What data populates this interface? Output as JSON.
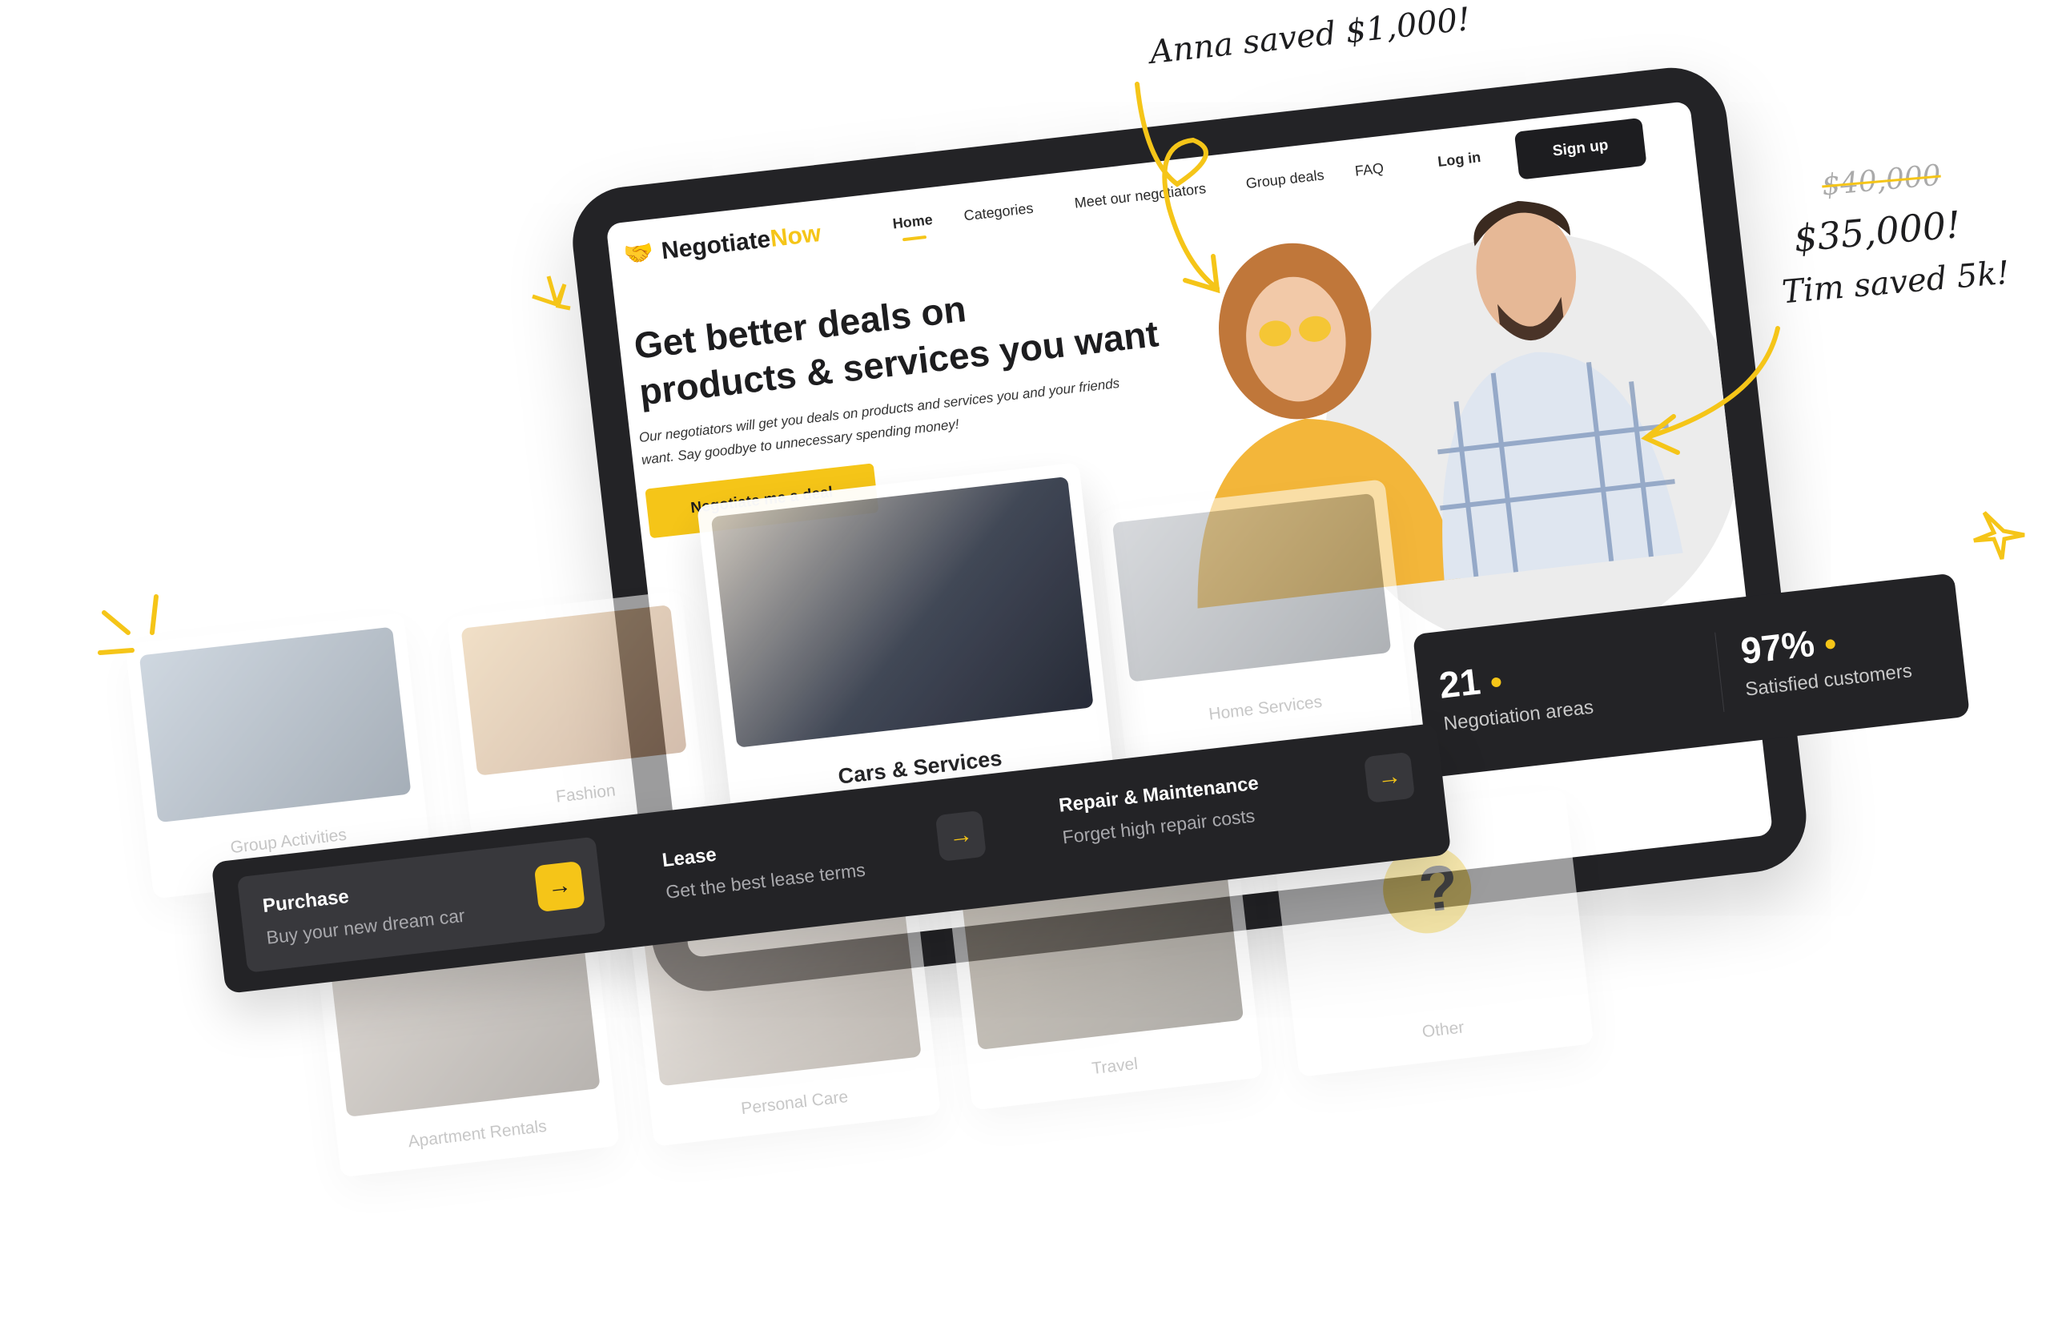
{
  "brand": {
    "name_part1": "Negotiate",
    "name_part2": "Now",
    "accent_color": "#f5c518",
    "dark_color": "#232326"
  },
  "nav": {
    "items": [
      "Home",
      "Categories",
      "Meet our negotiators",
      "Group deals",
      "FAQ"
    ],
    "active": "Home",
    "login": "Log in",
    "signup": "Sign up"
  },
  "hero": {
    "headline_line1": "Get better deals on",
    "headline_line2": "products & services you want",
    "subtext": "Our negotiators will get you deals on products and services you and your friends want. Say goodbye to unnecessary spending money!",
    "cta": "Negotiate me a deal"
  },
  "stats": [
    {
      "value": "21",
      "label": "Negotiation areas"
    },
    {
      "value": "97%",
      "label": "Satisfied customers"
    }
  ],
  "categories": [
    "Group Activities",
    "Fashion",
    "Cars & Services",
    "Home Services",
    "Apartment Rentals",
    "Personal Care",
    "Travel",
    "Other"
  ],
  "car_options": [
    {
      "title": "Purchase",
      "subtitle": "Buy your new dream car",
      "icon": "arrow-right-icon"
    },
    {
      "title": "Lease",
      "subtitle": "Get the best lease terms",
      "icon": "arrow-right-icon"
    },
    {
      "title": "Repair & Maintenance",
      "subtitle": "Forget high repair costs",
      "icon": "arrow-right-icon"
    }
  ],
  "annotations": {
    "anna": "Anna saved $1,000!",
    "old_price": "$40,000",
    "new_price": "$35,000!",
    "tim": "Tim saved 5k!"
  }
}
